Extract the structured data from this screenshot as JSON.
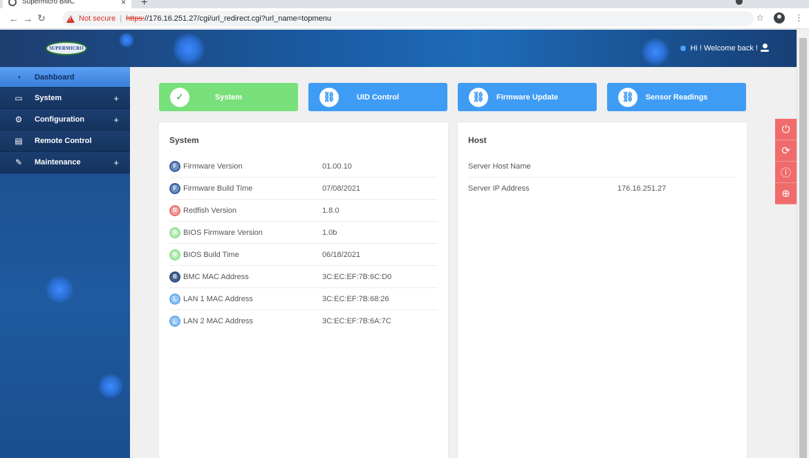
{
  "browser": {
    "tab_title": "Supermicro BMC",
    "tab_close": "×",
    "new_tab": "+",
    "not_secure": "Not secure",
    "separator": "|",
    "url_scheme": "https:",
    "url_rest": "//176.16.251.27/cgi/url_redirect.cgi?url_name=topmenu",
    "back_glyph": "←",
    "forward_glyph": "→",
    "reload_glyph": "↻",
    "star_glyph": "☆",
    "menu_glyph": "⋮"
  },
  "header": {
    "logo_text": "SUPERMICRO",
    "welcome": "Hi ! Welcome back !"
  },
  "sidebar": {
    "items": [
      {
        "label": "Dashboard",
        "icon": "speedometer-icon",
        "glyph": "◔"
      },
      {
        "label": "System",
        "icon": "monitor-icon",
        "glyph": "▭",
        "expand": "+"
      },
      {
        "label": "Configuration",
        "icon": "gear-icon",
        "glyph": "⚙",
        "expand": "+"
      },
      {
        "label": "Remote Control",
        "icon": "console-icon",
        "glyph": "▤"
      },
      {
        "label": "Maintenance",
        "icon": "wrench-icon",
        "glyph": "✎",
        "expand": "+"
      }
    ]
  },
  "quick_buttons": [
    {
      "label": "System",
      "icon": "check-icon",
      "glyph": "✓",
      "color": "#77e07a"
    },
    {
      "label": "UID Control",
      "icon": "link-icon",
      "glyph": "⛓",
      "color": "#3f9cf5"
    },
    {
      "label": "Firmware Update",
      "icon": "link-icon",
      "glyph": "⛓",
      "color": "#3f9cf5"
    },
    {
      "label": "Sensor Readings",
      "icon": "link-icon",
      "glyph": "⛓",
      "color": "#3f9cf5"
    }
  ],
  "system_card": {
    "title": "System",
    "rows": [
      {
        "badge": "F",
        "label": "Firmware Version",
        "value": "01.00.10"
      },
      {
        "badge": "F",
        "label": "Firmware Build Time",
        "value": "07/08/2021"
      },
      {
        "badge": "R",
        "label": "Redfish Version",
        "value": "1.8.0"
      },
      {
        "badge": "B",
        "label": "BIOS Firmware Version",
        "value": "1.0b"
      },
      {
        "badge": "B",
        "label": "BIOS Build Time",
        "value": "06/18/2021"
      },
      {
        "badge": "B",
        "label": "BMC MAC Address",
        "value": "3C:EC:EF:7B:6C:D0"
      },
      {
        "badge": "L",
        "label": "LAN 1 MAC Address",
        "value": "3C:EC:EF:7B:68:26"
      },
      {
        "badge": "L",
        "label": "LAN 2 MAC Address",
        "value": "3C:EC:EF:7B:6A:7C"
      }
    ]
  },
  "host_card": {
    "title": "Host",
    "rows": [
      {
        "label": "Server Host Name",
        "value": ""
      },
      {
        "label": "Server IP Address",
        "value": "176.16.251.27"
      }
    ]
  },
  "rail": [
    {
      "icon": "power-icon",
      "glyph": "⏻"
    },
    {
      "icon": "refresh-icon",
      "glyph": "⟳"
    },
    {
      "icon": "info-icon",
      "glyph": "ⓘ"
    },
    {
      "icon": "globe-icon",
      "glyph": "⊕"
    }
  ]
}
